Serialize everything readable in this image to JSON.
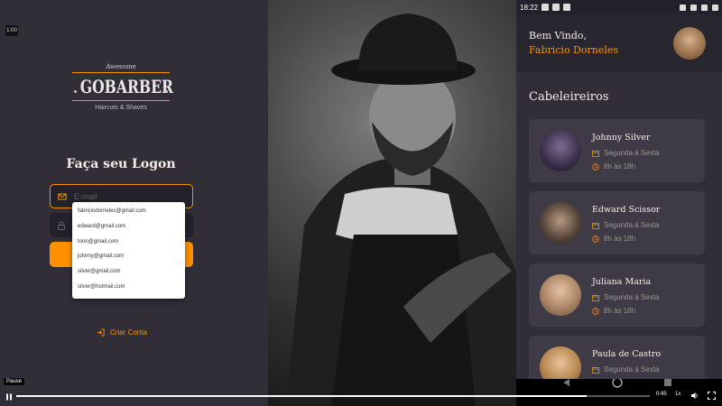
{
  "video": {
    "badge": "1:00",
    "current_time": "0:45",
    "speed": "1x",
    "pause_tooltip": "Pause",
    "progress": 0.9
  },
  "login": {
    "logo": {
      "top": "Awesome",
      "name": "GOBARBER",
      "sub": "Haircuts & Shaves"
    },
    "title": "Faça seu Logon",
    "email_placeholder": "E-mail",
    "create_account": "Criar Conta",
    "autocomplete": [
      "fabriciodorneles@gmail.com",
      "edward@gmail.com",
      "toon@gmail.com",
      "johnny@gmail.com",
      "silver@gmail.com",
      "silver@hotmail.com"
    ]
  },
  "phone": {
    "status_time": "18:22",
    "welcome": "Bem Vindo,",
    "user_name": "Fabricio Dorneles",
    "section_title": "Cabeleireiros",
    "barbers": [
      {
        "name": "Johnny Silver",
        "days": "Segunda à Sexta",
        "hours": "8h às 18h"
      },
      {
        "name": "Edward Scissor",
        "days": "Segunda à Sexta",
        "hours": "8h às 18h"
      },
      {
        "name": "Juliana Maria",
        "days": "Segunda à Sexta",
        "hours": "8h às 18h"
      },
      {
        "name": "Paula de Castro",
        "days": "Segunda à Sexta",
        "hours": ""
      }
    ]
  },
  "colors": {
    "accent": "#ff9000",
    "background": "#312e38",
    "card": "#3e3b47",
    "input": "#232129"
  }
}
